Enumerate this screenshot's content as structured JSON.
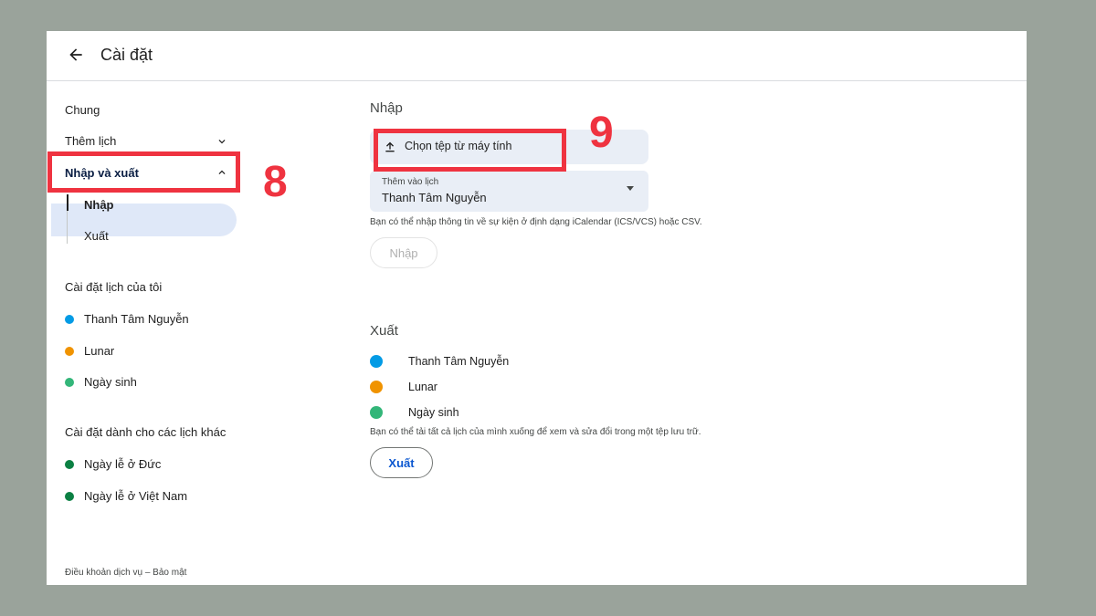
{
  "header": {
    "title": "Cài đặt"
  },
  "sidebar": {
    "general": "Chung",
    "add_calendar": "Thêm lịch",
    "import_export": "Nhập và xuất",
    "sub_import": "Nhập",
    "sub_export": "Xuất",
    "my_calendars_title": "Cài đặt lịch của tôi",
    "my_calendars": [
      {
        "name": "Thanh Tâm Nguyễn",
        "color": "#039be5"
      },
      {
        "name": "Lunar",
        "color": "#f09300"
      },
      {
        "name": "Ngày sinh",
        "color": "#33b679"
      }
    ],
    "other_calendars_title": "Cài đặt dành cho các lịch khác",
    "other_calendars": [
      {
        "name": "Ngày lễ ở Đức",
        "color": "#0b8043"
      },
      {
        "name": "Ngày lễ ở Việt Nam",
        "color": "#0b8043"
      }
    ],
    "footer": "Điều khoản dịch vụ – Bảo mật"
  },
  "import": {
    "title": "Nhập",
    "file_button": "Chọn tệp từ máy tính",
    "select_caption": "Thêm vào lịch",
    "select_value": "Thanh Tâm Nguyễn",
    "help": "Bạn có thể nhập thông tin về sự kiện ở định dạng iCalendar (ICS/VCS) hoặc CSV.",
    "button": "Nhập"
  },
  "export": {
    "title": "Xuất",
    "calendars": [
      {
        "name": "Thanh Tâm Nguyễn",
        "color": "#039be5"
      },
      {
        "name": "Lunar",
        "color": "#f09300"
      },
      {
        "name": "Ngày sinh",
        "color": "#33b679"
      }
    ],
    "help": "Bạn có thể tải tất cả lịch của mình xuống để xem và sửa đổi trong một tệp lưu trữ.",
    "button": "Xuất"
  },
  "annotations": {
    "step_8": "8",
    "step_9": "9",
    "color": "#ef3340"
  }
}
